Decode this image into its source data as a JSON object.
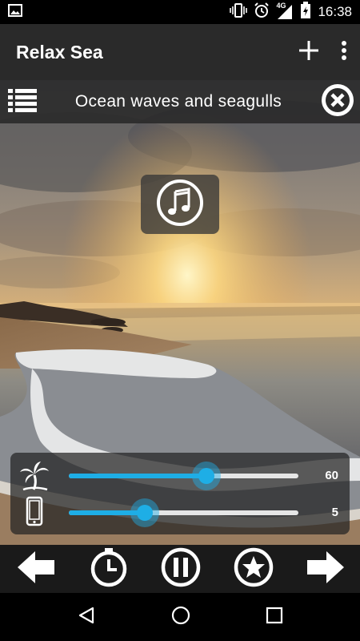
{
  "status_bar": {
    "time": "16:38",
    "network": "4G",
    "icons": [
      "image-icon",
      "vibrate-icon",
      "alarm-icon",
      "signal-icon",
      "battery-charging-icon"
    ]
  },
  "app_bar": {
    "title": "Relax Sea",
    "actions": [
      "add-icon",
      "overflow-menu-icon"
    ]
  },
  "track": {
    "title": "Ocean waves and seagulls",
    "icons": [
      "playlist-icon",
      "close-circle-icon"
    ]
  },
  "now_playing": {
    "icon": "music-note-icon"
  },
  "sliders": [
    {
      "label_icon": "palm-tree-icon",
      "value": 60,
      "value_text": "60",
      "fraction": 0.6
    },
    {
      "label_icon": "phone-icon",
      "value": 5,
      "value_text": "5",
      "fraction": 0.33
    }
  ],
  "controls": [
    "arrow-left-icon",
    "timer-icon",
    "pause-icon",
    "star-icon",
    "arrow-right-icon"
  ],
  "system_nav": [
    "back-icon",
    "home-icon",
    "recents-icon"
  ],
  "colors": {
    "accent": "#1eaee6",
    "app_bar": "#2a2a2a",
    "controls_bg": "#1a1a1a"
  }
}
